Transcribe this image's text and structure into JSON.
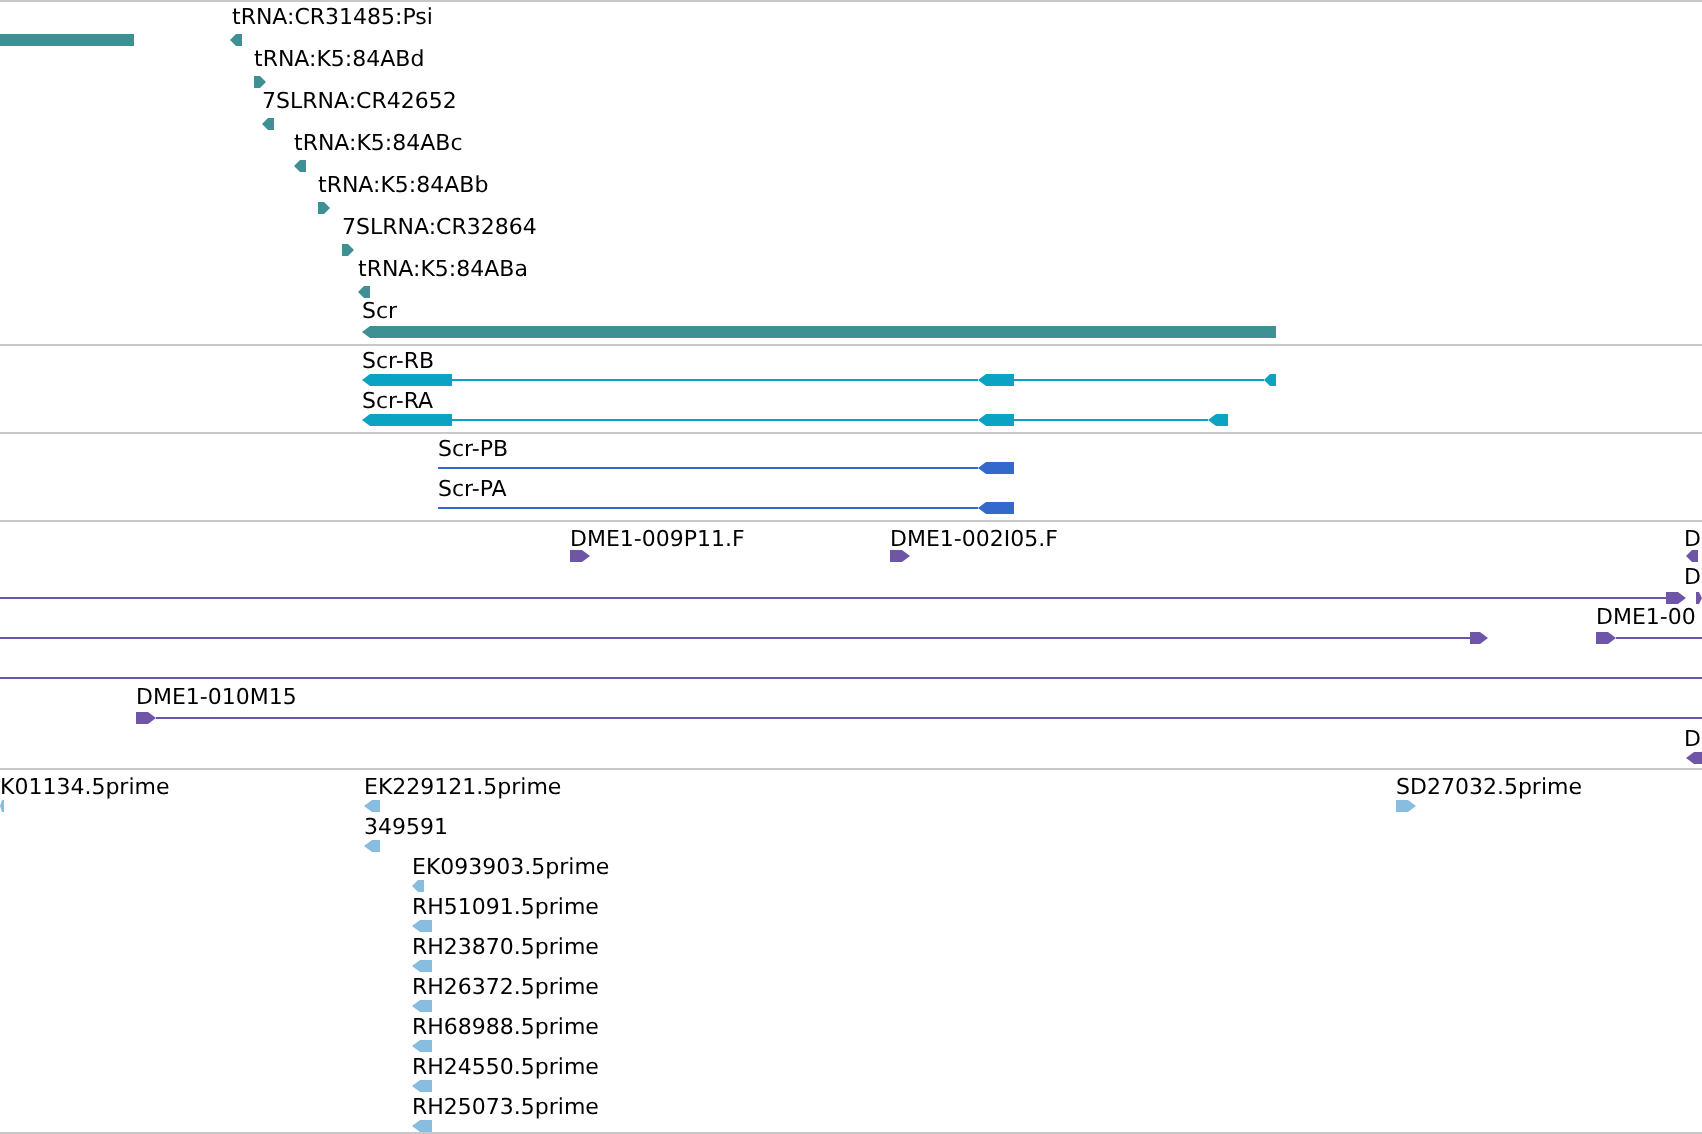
{
  "tracks": [
    {
      "color": "#3f9095",
      "features": [
        {
          "kind": "bar"
        },
        {
          "label": "tRNA:CR31485:Psi",
          "minus_strand": true
        },
        {
          "label": "tRNA:K5:84ABd",
          "minus_strand": false
        },
        {
          "label": "7SLRNA:CR42652",
          "minus_strand": true
        },
        {
          "label": "tRNA:K5:84ABc",
          "minus_strand": true
        },
        {
          "label": "tRNA:K5:84ABb",
          "minus_strand": false
        },
        {
          "label": "7SLRNA:CR32864",
          "minus_strand": false
        },
        {
          "label": "tRNA:K5:84ABa",
          "minus_strand": true
        },
        {
          "label": "Scr",
          "minus_strand": true
        }
      ]
    },
    {
      "color": "#0aa3c3",
      "features": [
        {
          "label": "Scr-RB",
          "minus_strand": true
        },
        {
          "label": "Scr-RA",
          "minus_strand": true
        }
      ]
    },
    {
      "color": "#3368cc",
      "features": [
        {
          "label": "Scr-PB",
          "minus_strand": true
        },
        {
          "label": "Scr-PA",
          "minus_strand": true
        }
      ]
    },
    {
      "color": "#6f55a8",
      "features": [
        {
          "label": "DME1-009P11.F",
          "minus_strand": false
        },
        {
          "label": "DME1-002I05.F",
          "minus_strand": false
        },
        {
          "label": "D",
          "minus_strand": true
        },
        {
          "minus_strand": false
        },
        {
          "label": "D",
          "minus_strand": false
        },
        {
          "minus_strand": false
        },
        {
          "label": "DME1-00",
          "minus_strand": false
        },
        {
          "minus_strand": false
        },
        {
          "label": "DME1-010M15",
          "minus_strand": false
        },
        {
          "label": "D",
          "minus_strand": true
        }
      ]
    },
    {
      "color": "#88bde0",
      "features": [
        {
          "label": "K01134.5prime",
          "minus_strand": true
        },
        {
          "label": "EK229121.5prime",
          "minus_strand": true
        },
        {
          "label": "349591",
          "minus_strand": true
        },
        {
          "label": "EK093903.5prime",
          "minus_strand": true
        },
        {
          "label": "RH51091.5prime",
          "minus_strand": true
        },
        {
          "label": "RH23870.5prime",
          "minus_strand": true
        },
        {
          "label": "RH26372.5prime",
          "minus_strand": true
        },
        {
          "label": "RH68988.5prime",
          "minus_strand": true
        },
        {
          "label": "RH24550.5prime",
          "minus_strand": true
        },
        {
          "label": "RH25073.5prime",
          "minus_strand": true
        },
        {
          "label": "SD27032.5prime",
          "minus_strand": false
        }
      ]
    }
  ]
}
